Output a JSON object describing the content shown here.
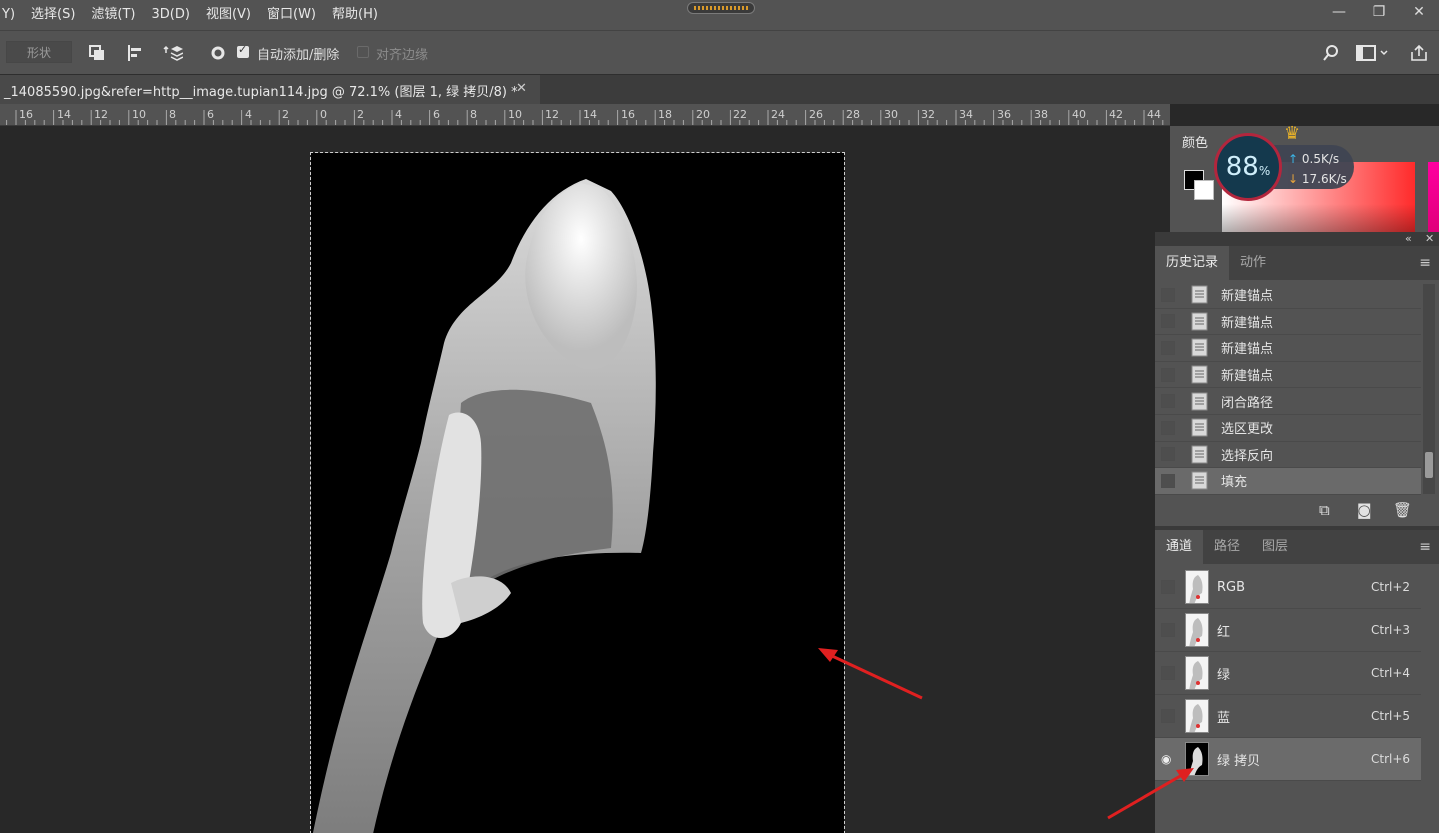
{
  "menu": {
    "items": [
      "Y)",
      "选择(S)",
      "滤镜(T)",
      "3D(D)",
      "视图(V)",
      "窗口(W)",
      "帮助(H)"
    ],
    "window_controls": [
      "—",
      "❐",
      "✕"
    ]
  },
  "options": {
    "shape_label": "形状",
    "auto_add_delete_label": "自动添加/删除",
    "auto_add_delete_checked": true,
    "align_edges_label": "对齐边缘",
    "align_edges_checked": false
  },
  "document_tab": {
    "title": "_14085590.jpg&refer=http__image.tupian114.jpg  @  72.1%  (图层 1, 绿 拷贝/8) *",
    "close": "✕"
  },
  "ruler": {
    "labels": [
      "16",
      "14",
      "12",
      "10",
      "8",
      "6",
      "4",
      "2",
      "0",
      "2",
      "4",
      "6",
      "8",
      "10",
      "12",
      "14",
      "16",
      "18",
      "20",
      "22",
      "24",
      "26",
      "28",
      "30",
      "32",
      "34",
      "36",
      "38",
      "40",
      "42",
      "44"
    ]
  },
  "color_panel": {
    "tab": "颜色",
    "foreground": "#000000",
    "background": "#ffffff"
  },
  "speed_widget": {
    "percent": "88",
    "percent_sign": "%",
    "upload": "0.5",
    "download": "17.6",
    "unit": "K/s",
    "up_arrow": "↑",
    "down_arrow": "↓",
    "badge": "VIP"
  },
  "history_panel": {
    "tabs": [
      "历史记录",
      "动作"
    ],
    "items": [
      {
        "label": "新建锚点",
        "active": false
      },
      {
        "label": "新建锚点",
        "active": false
      },
      {
        "label": "新建锚点",
        "active": false
      },
      {
        "label": "新建锚点",
        "active": false
      },
      {
        "label": "闭合路径",
        "active": false
      },
      {
        "label": "选区更改",
        "active": false
      },
      {
        "label": "选择反向",
        "active": false
      },
      {
        "label": "填充",
        "active": true
      }
    ]
  },
  "channels_panel": {
    "tabs": [
      "通道",
      "路径",
      "图层"
    ],
    "channels": [
      {
        "name": "RGB",
        "shortcut": "Ctrl+2",
        "visible": false,
        "active": false
      },
      {
        "name": "红",
        "shortcut": "Ctrl+3",
        "visible": false,
        "active": false
      },
      {
        "name": "绿",
        "shortcut": "Ctrl+4",
        "visible": false,
        "active": false
      },
      {
        "name": "蓝",
        "shortcut": "Ctrl+5",
        "visible": false,
        "active": false
      },
      {
        "name": "绿 拷贝",
        "shortcut": "Ctrl+6",
        "visible": true,
        "active": true
      }
    ]
  },
  "colors": {
    "panel": "#535353",
    "canvas_bg": "#282828",
    "annotation_arrow": "#e02020"
  }
}
